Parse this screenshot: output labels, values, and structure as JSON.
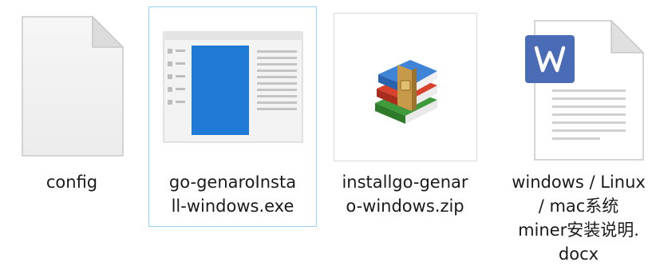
{
  "files": [
    {
      "name_lines": [
        "config"
      ],
      "icon": "blank-document-icon"
    },
    {
      "name_lines": [
        "go-genaroInsta",
        "ll-windows.exe"
      ],
      "icon": "exe-window-icon",
      "selected": true
    },
    {
      "name_lines": [
        "installgo-genar",
        "o-windows.zip"
      ],
      "icon": "winrar-archive-icon"
    },
    {
      "name_lines": [
        "windows / Linux",
        "/ mac系统",
        "miner安装说明.",
        "docx"
      ],
      "icon": "word-document-icon"
    }
  ],
  "colors": {
    "selection_border": "#99d1ff",
    "word_blue": "#4a6bb5",
    "exe_blue": "#1f7ad6"
  }
}
